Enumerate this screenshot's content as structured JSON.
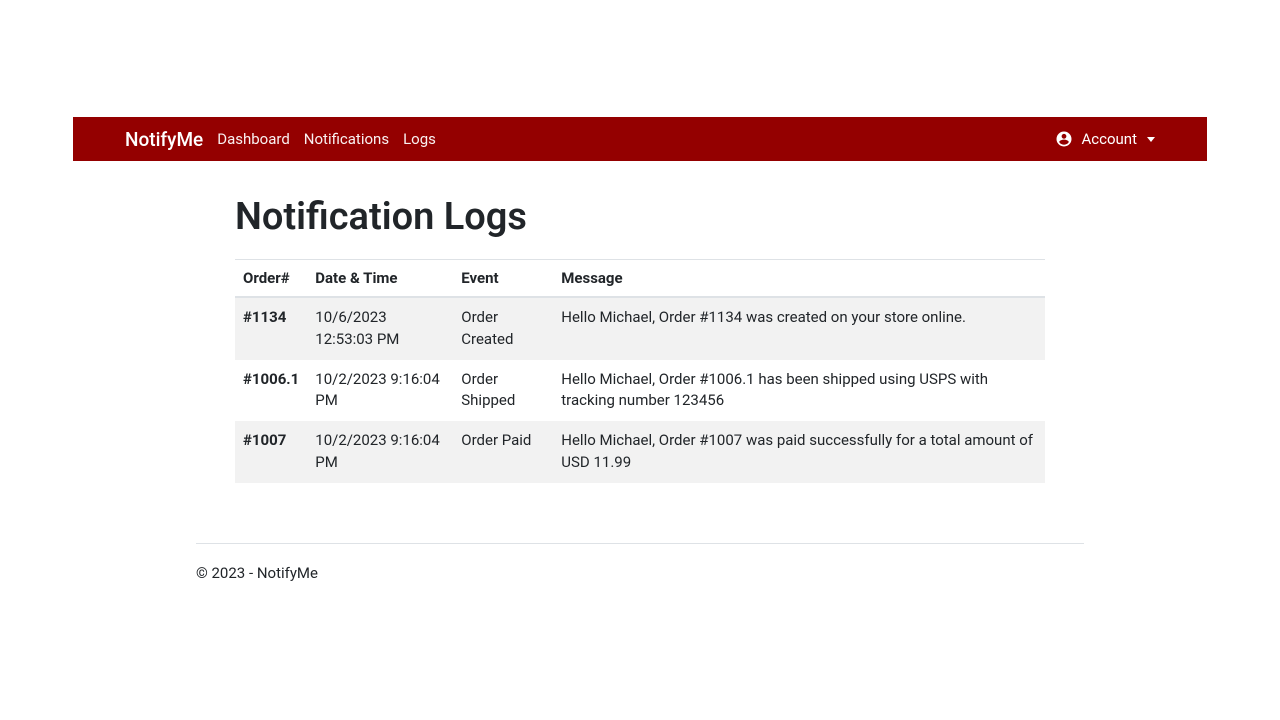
{
  "brand": "NotifyMe",
  "nav": {
    "items": [
      "Dashboard",
      "Notifications",
      "Logs"
    ],
    "account_label": "Account"
  },
  "page": {
    "title": "Notification Logs"
  },
  "table": {
    "headers": [
      "Order#",
      "Date & Time",
      "Event",
      "Message"
    ],
    "rows": [
      {
        "order": "#1134",
        "datetime": "10/6/2023 12:53:03 PM",
        "event": "Order Created",
        "message": "Hello Michael, Order #1134 was created on your store online."
      },
      {
        "order": "#1006.1",
        "datetime": "10/2/2023 9:16:04 PM",
        "event": "Order Shipped",
        "message": "Hello Michael, Order #1006.1 has been shipped using USPS with tracking number 123456"
      },
      {
        "order": "#1007",
        "datetime": "10/2/2023 9:16:04 PM",
        "event": "Order Paid",
        "message": "Hello Michael, Order #1007 was paid successfully for a total amount of USD 11.99"
      }
    ]
  },
  "footer": "© 2023 - NotifyMe"
}
